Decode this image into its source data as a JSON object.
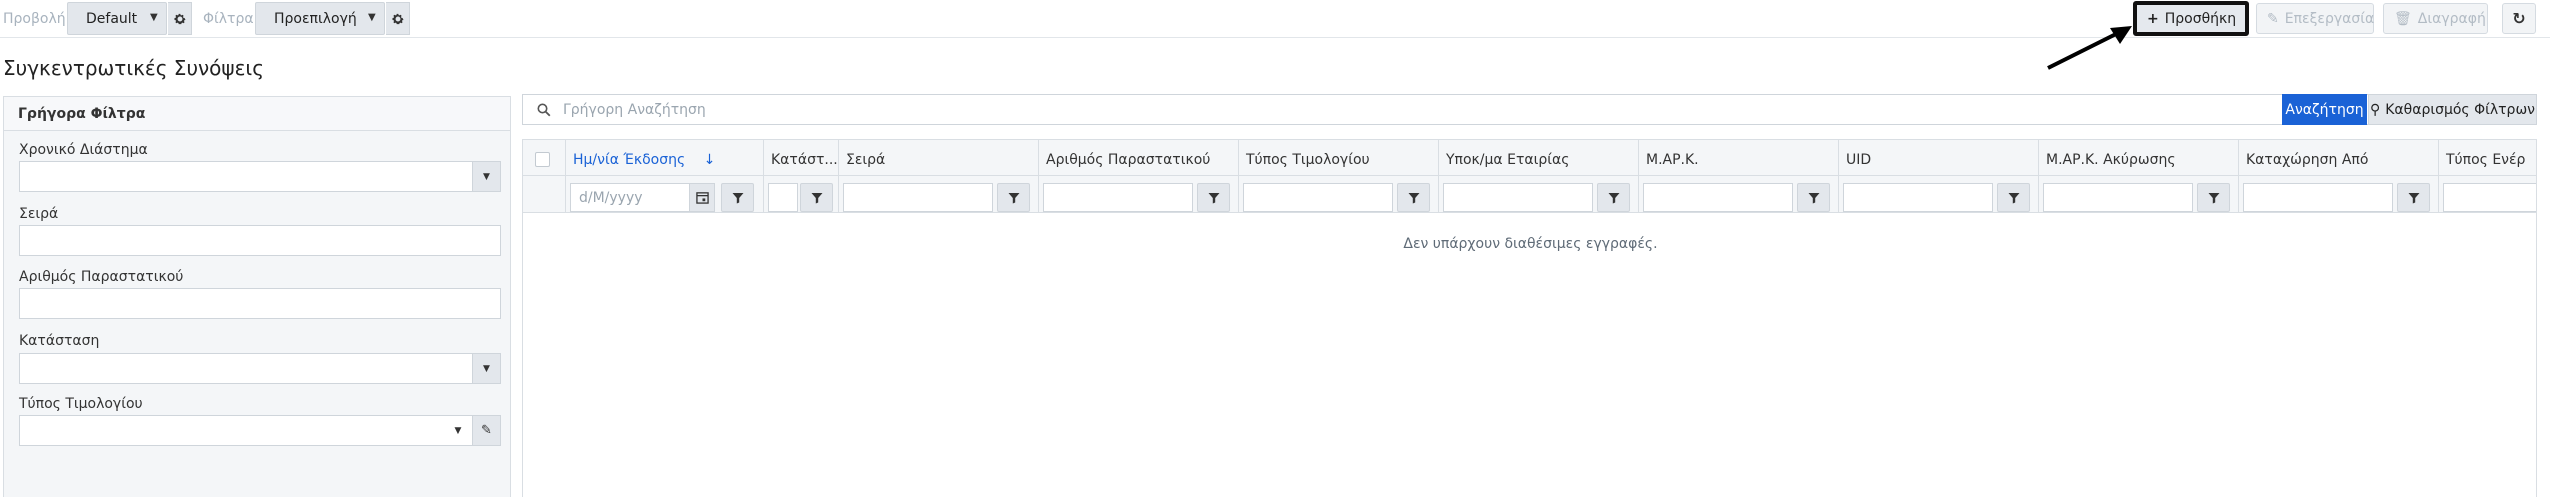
{
  "toolbar": {
    "view_label": "Προβολή",
    "view_value": "Default",
    "filters_label": "Φίλτρα",
    "filters_value": "Προεπιλογή",
    "add_label": "Προσθήκη",
    "edit_label": "Επεξεργασία",
    "delete_label": "Διαγραφή"
  },
  "page": {
    "title": "Συγκεντρωτικές Συνόψεις"
  },
  "quick_filters": {
    "title": "Γρήγορα Φίλτρα",
    "fields": [
      {
        "label": "Χρονικό Διάστημα",
        "value": ""
      },
      {
        "label": "Σειρά",
        "value": ""
      },
      {
        "label": "Αριθμός Παραστατικού",
        "value": ""
      },
      {
        "label": "Κατάσταση",
        "value": ""
      },
      {
        "label": "Τύπος Τιμολογίου",
        "value": ""
      }
    ]
  },
  "search": {
    "placeholder": "Γρήγορη Αναζήτηση",
    "search_button": "Αναζήτηση",
    "clear_button": "Καθαρισμός Φίλτρων"
  },
  "grid": {
    "columns": [
      "Ημ/νία Έκδοσης",
      "Κατάστ...",
      "Σειρά",
      "Αριθμός Παραστατικού",
      "Τύπος Τιμολογίου",
      "Υποκ/μα Εταιρίας",
      "Μ.ΑΡ.Κ.",
      "UID",
      "Μ.ΑΡ.Κ. Ακύρωσης",
      "Καταχώρηση Από",
      "Τύπος Ενέρ"
    ],
    "sort_indicator": "↓",
    "date_placeholder": "d/M/yyyy",
    "empty_message": "Δεν υπάρχουν διαθέσιμες εγγραφές."
  },
  "colors": {
    "accent": "#1a62d6",
    "highlight_border": "#111111"
  }
}
